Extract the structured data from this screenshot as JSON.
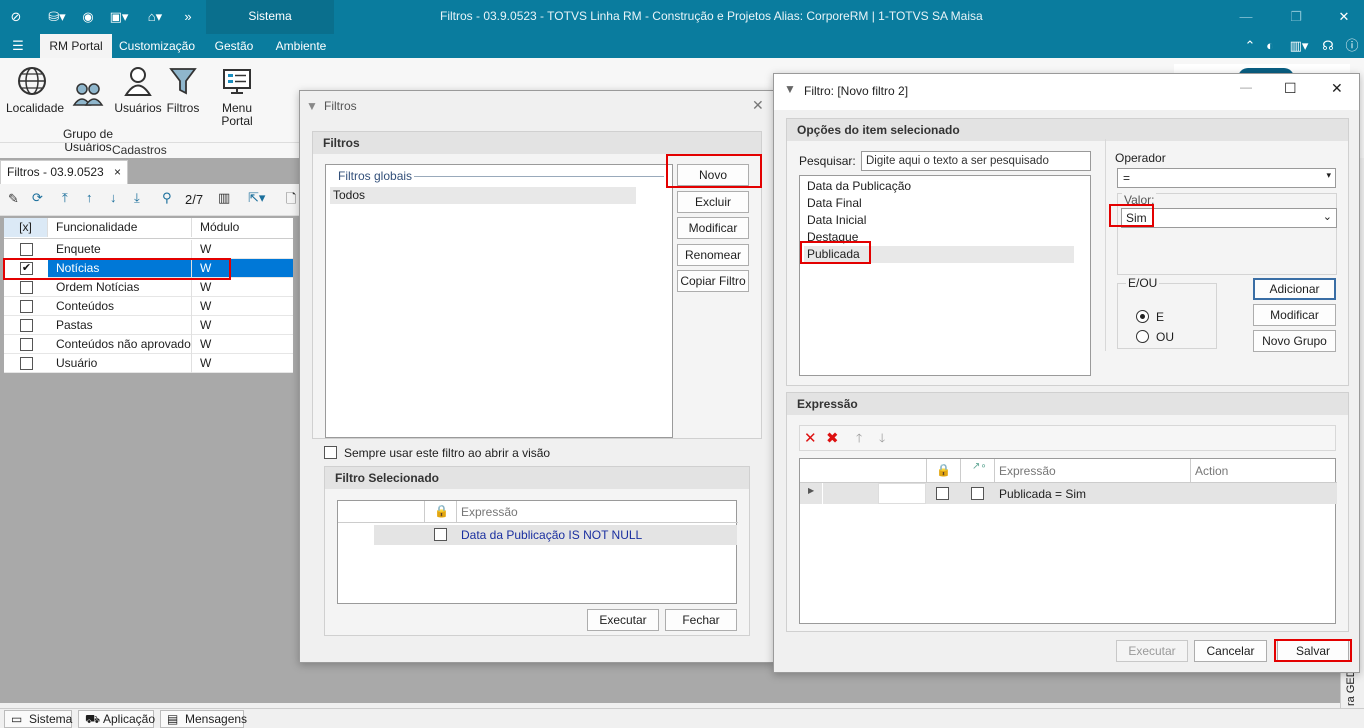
{
  "app": {
    "system_tab": "Sistema",
    "window_title": "Filtros - 03.9.0523 - TOTVS Linha RM - Construção e Projetos  Alias: CorporeRM | 1-TOTVS SA Maisa"
  },
  "menu": {
    "items": [
      "RM Portal",
      "Customização",
      "Gestão",
      "Ambiente"
    ]
  },
  "ribbon": {
    "buttons": [
      {
        "label": "Localidade",
        "icon": "globe-icon"
      },
      {
        "label": "Grupo de\nUsuários",
        "icon": "users-group-icon"
      },
      {
        "label": "Usuários",
        "icon": "user-icon"
      },
      {
        "label": "Filtros",
        "icon": "funnel-icon"
      },
      {
        "label": "Menu Portal",
        "icon": "portal-menu-icon"
      }
    ],
    "group_label": "Cadastros"
  },
  "doc_tab": {
    "label": "Filtros - 03.9.0523",
    "close": "×"
  },
  "list_toolbar": {
    "pager": "2/7"
  },
  "grid": {
    "headers": [
      "[x]",
      "Funcionalidade",
      "Módulo"
    ],
    "rows": [
      {
        "name": "Enquete",
        "module": "W",
        "checked": false
      },
      {
        "name": "Notícias",
        "module": "W",
        "checked": true
      },
      {
        "name": "Ordem Notícias",
        "module": "W",
        "checked": false
      },
      {
        "name": "Conteúdos",
        "module": "W",
        "checked": false
      },
      {
        "name": "Pastas",
        "module": "W",
        "checked": false
      },
      {
        "name": "Conteúdos não aprovados",
        "module": "W",
        "checked": false
      },
      {
        "name": "Usuário",
        "module": "W",
        "checked": false
      }
    ]
  },
  "filtros_dialog": {
    "title": "Filtros",
    "section_title": "Filtros",
    "global_label": "Filtros globais",
    "items": [
      "Todos"
    ],
    "buttons": [
      "Novo",
      "Excluir",
      "Modificar",
      "Renomear",
      "Copiar Filtro"
    ],
    "always_use_label": "Sempre usar este filtro ao abrir a visão",
    "selected_title": "Filtro Selecionado",
    "expr_header": "Expressão",
    "expr_value": "Data da Publicação IS NOT NULL",
    "execute": "Executar",
    "close": "Fechar"
  },
  "novo_dialog": {
    "title": "Filtro: [Novo filtro 2]",
    "options_title": "Opções do item selecionado",
    "search_label": "Pesquisar:",
    "search_placeholder": "Digite aqui o texto a ser pesquisado",
    "fields": [
      "Data da Publicação",
      "Data Final",
      "Data Inicial",
      "Destaque",
      "Publicada"
    ],
    "operator_label": "Operador",
    "operator_value": "=",
    "value_label": "Valor:",
    "value_value": "Sim",
    "eou_label": "E/OU",
    "radio_e": "E",
    "radio_ou": "OU",
    "btn_add": "Adicionar",
    "btn_modify": "Modificar",
    "btn_new_group": "Novo Grupo",
    "expression_title": "Expressão",
    "expr_headers": [
      "Expressão",
      "Action"
    ],
    "expr_row": "Publicada = Sim",
    "btn_execute": "Executar",
    "btn_cancel": "Cancelar",
    "btn_save": "Salvar"
  },
  "right_edge": {
    "vertical_text": "ra GED"
  },
  "statusbar": {
    "tabs": [
      "Sistema",
      "Aplicação",
      "Mensagens"
    ]
  },
  "colors": {
    "brand": "#0a7c9e",
    "highlight_red": "#e30000",
    "selection": "#0078d7"
  }
}
